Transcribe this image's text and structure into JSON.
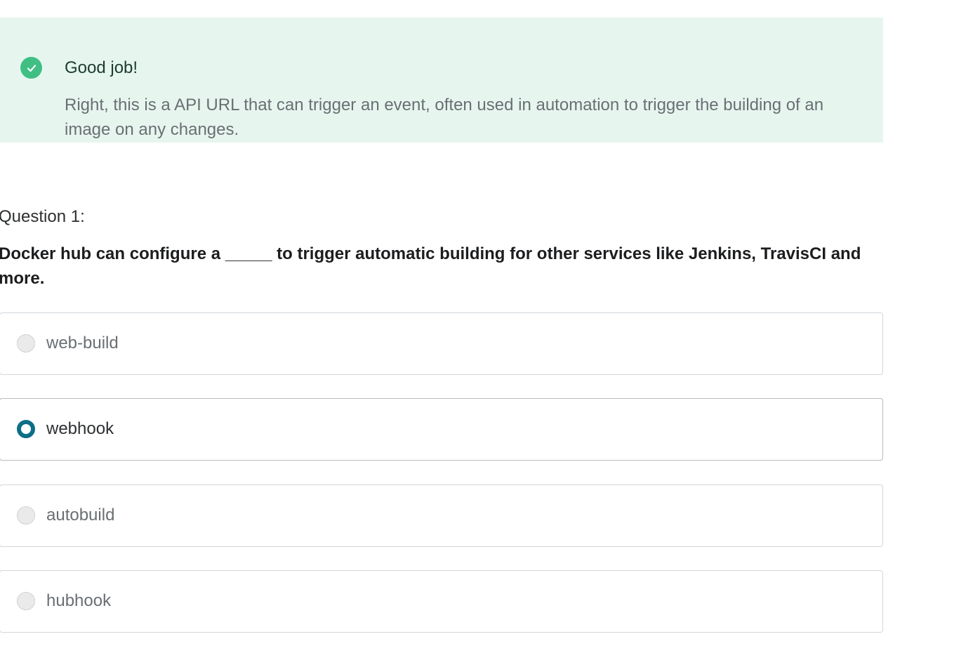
{
  "feedback": {
    "status": "correct",
    "icon": "check-circle-icon",
    "title": "Good job!",
    "body": "Right, this is a API URL that can trigger an event, often used in automation to trigger the building of an image on any changes."
  },
  "question": {
    "label": "Question 1:",
    "text": "Docker hub can configure a _____ to trigger automatic building for other services like Jenkins, TravisCI and more."
  },
  "options": [
    {
      "label": "web-build",
      "selected": false
    },
    {
      "label": "webhook",
      "selected": true
    },
    {
      "label": "autobuild",
      "selected": false
    },
    {
      "label": "hubhook",
      "selected": false
    }
  ],
  "colors": {
    "feedback_bg": "#e6f6ef",
    "check_green": "#3fbf84",
    "radio_selected": "#0d6e87"
  }
}
